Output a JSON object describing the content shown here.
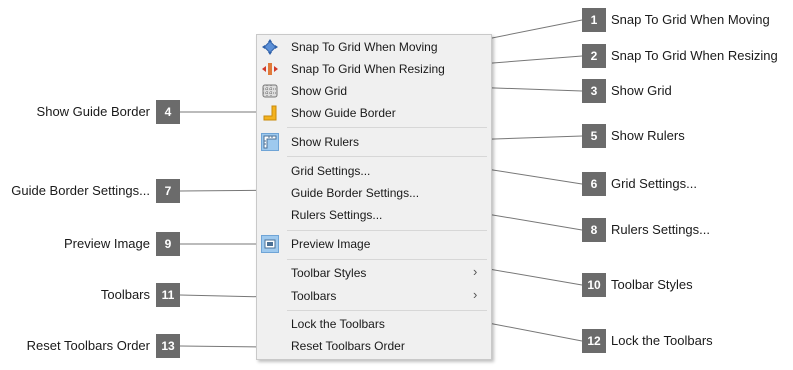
{
  "menu": {
    "items": [
      {
        "label": "Snap To Grid When Moving",
        "icon": "snap-move-icon"
      },
      {
        "label": "Snap To Grid When Resizing",
        "icon": "snap-resize-icon"
      },
      {
        "label": "Show Grid",
        "icon": "grid-icon"
      },
      {
        "label": "Show Guide Border",
        "icon": "guide-border-icon"
      },
      {
        "label": "Show Rulers",
        "icon": "ruler-icon"
      },
      {
        "label": "Grid Settings..."
      },
      {
        "label": "Guide Border Settings..."
      },
      {
        "label": "Rulers Settings..."
      },
      {
        "label": "Preview Image",
        "icon": "preview-image-icon"
      },
      {
        "label": "Toolbar Styles",
        "submenu": true
      },
      {
        "label": "Toolbars",
        "submenu": true
      },
      {
        "label": "Lock the Toolbars"
      },
      {
        "label": "Reset Toolbars Order"
      }
    ]
  },
  "callouts": [
    {
      "number": "1",
      "text": "Snap To Grid When Moving"
    },
    {
      "number": "2",
      "text": "Snap To Grid When Resizing"
    },
    {
      "number": "3",
      "text": "Show Grid"
    },
    {
      "number": "4",
      "text": "Show Guide Border"
    },
    {
      "number": "5",
      "text": "Show Rulers"
    },
    {
      "number": "6",
      "text": "Grid Settings..."
    },
    {
      "number": "7",
      "text": "Guide Border Settings..."
    },
    {
      "number": "8",
      "text": "Rulers Settings..."
    },
    {
      "number": "9",
      "text": "Preview Image"
    },
    {
      "number": "10",
      "text": "Toolbar Styles"
    },
    {
      "number": "11",
      "text": "Toolbars"
    },
    {
      "number": "12",
      "text": "Lock the Toolbars"
    },
    {
      "number": "13",
      "text": "Reset Toolbars Order"
    }
  ],
  "colors": {
    "callout_bg": "#6b6b6b",
    "menu_bg": "#f0f0f0",
    "icon_highlight": "#9ec9ee"
  }
}
